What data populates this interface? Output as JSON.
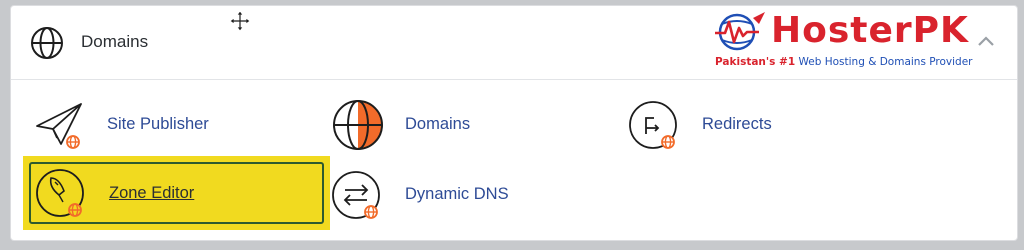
{
  "header": {
    "title": "Domains",
    "globe_icon": "globe-icon",
    "move_icon": "move-icon",
    "collapse_icon": "chevron-up-icon"
  },
  "brand": {
    "name": "HosterPK",
    "tagline_prefix": "Pakistan's #1",
    "tagline_rest": "Web Hosting & Domains Provider",
    "colors": {
      "red": "#d9232d",
      "blue": "#1f4fb5"
    }
  },
  "items": [
    {
      "label": "Site Publisher",
      "icon": "paper-plane-icon"
    },
    {
      "label": "Domains",
      "icon": "globe-icon"
    },
    {
      "label": "Redirects",
      "icon": "redirect-arrow-icon"
    },
    {
      "label": "Zone Editor",
      "icon": "rocket-icon",
      "highlighted": true
    },
    {
      "label": "Dynamic DNS",
      "icon": "swap-arrows-icon"
    }
  ],
  "colors": {
    "accent_orange": "#f26b2a",
    "highlight": "#f1da1f",
    "link": "#2e4b96"
  }
}
